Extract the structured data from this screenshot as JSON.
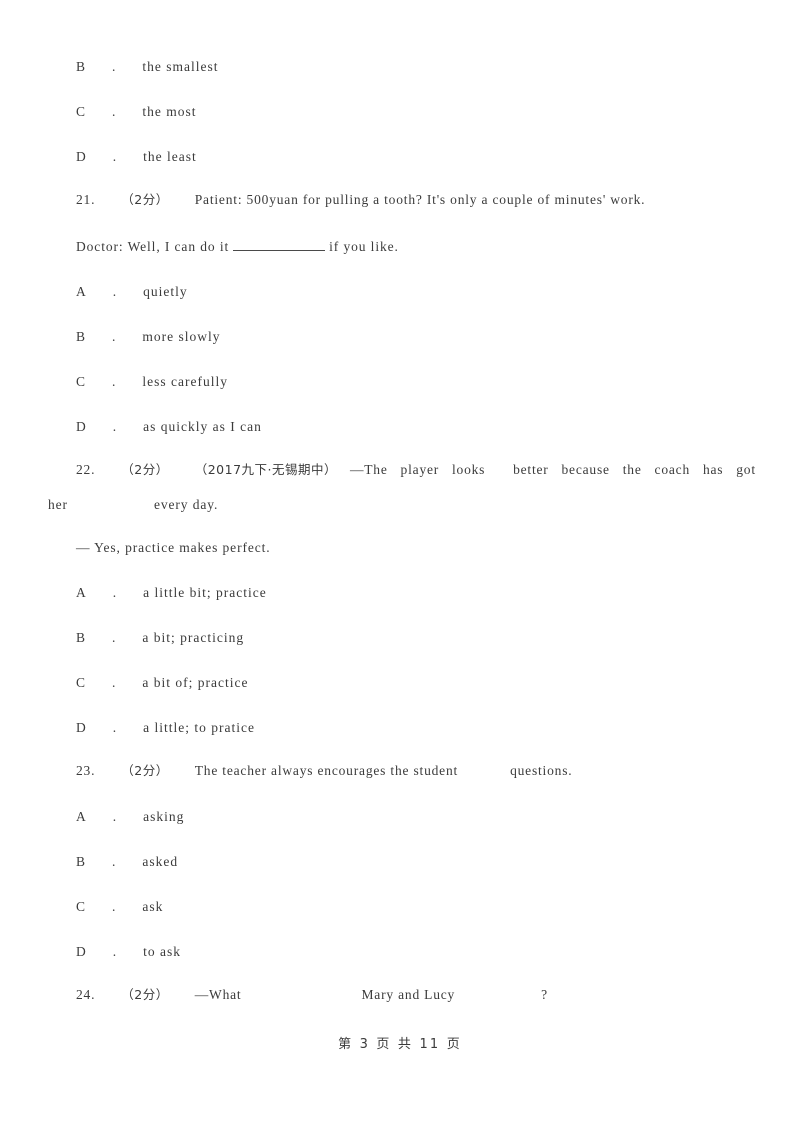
{
  "document": {
    "type": "exam-worksheet",
    "language": "en-zh",
    "text_color": "#3b3b3b",
    "background_color": "#ffffff"
  },
  "orphan_options": [
    {
      "letter": "B",
      "sep": ".",
      "text": "the smallest"
    },
    {
      "letter": "C",
      "sep": ".",
      "text": "the most"
    },
    {
      "letter": "D",
      "sep": ".",
      "text": "the least"
    }
  ],
  "questions": [
    {
      "number": "21.",
      "score": "（2分）",
      "stem_line1": "Patient: 500yuan for pulling a tooth? It's only a couple of minutes' work.",
      "stem_line2_prefix": "Doctor: Well, I can do it",
      "stem_line2_suffix": "if you like.",
      "options": [
        {
          "letter": "A",
          "sep": ".",
          "text": "quietly"
        },
        {
          "letter": "B",
          "sep": ".",
          "text": "more slowly"
        },
        {
          "letter": "C",
          "sep": ".",
          "text": "less carefully"
        },
        {
          "letter": "D",
          "sep": ".",
          "text": "as quickly as I can"
        }
      ]
    },
    {
      "number": "22.",
      "score": "（2分）",
      "source": "（2017九下·无锡期中）",
      "stem_seg1": "—The",
      "stem_seg2": "player",
      "stem_seg3": "looks",
      "stem_seg4": "better",
      "stem_seg5": "because",
      "stem_seg6": "the",
      "stem_seg7": "coach",
      "stem_seg8": "has",
      "stem_seg9": "got",
      "stem_cont_a": "her",
      "stem_cont_b": "every day.",
      "answer_line": "— Yes, practice makes perfect.",
      "options": [
        {
          "letter": "A",
          "sep": ".",
          "text": "a little bit; practice"
        },
        {
          "letter": "B",
          "sep": ".",
          "text": "a bit; practicing"
        },
        {
          "letter": "C",
          "sep": ".",
          "text": "a bit of; practice"
        },
        {
          "letter": "D",
          "sep": ".",
          "text": "a little; to pratice"
        }
      ]
    },
    {
      "number": "23.",
      "score": "（2分）",
      "stem_prefix": "The teacher always encourages the student",
      "stem_suffix": "questions.",
      "options": [
        {
          "letter": "A",
          "sep": ".",
          "text": "asking"
        },
        {
          "letter": "B",
          "sep": ".",
          "text": "asked"
        },
        {
          "letter": "C",
          "sep": ".",
          "text": "ask"
        },
        {
          "letter": "D",
          "sep": ".",
          "text": "to ask"
        }
      ]
    },
    {
      "number": "24.",
      "score": "（2分）",
      "stem_seg1": "—What",
      "stem_seg2": "Mary and Lucy",
      "stem_seg3": "?"
    }
  ],
  "footer": {
    "text": "第 3 页 共 11 页"
  }
}
